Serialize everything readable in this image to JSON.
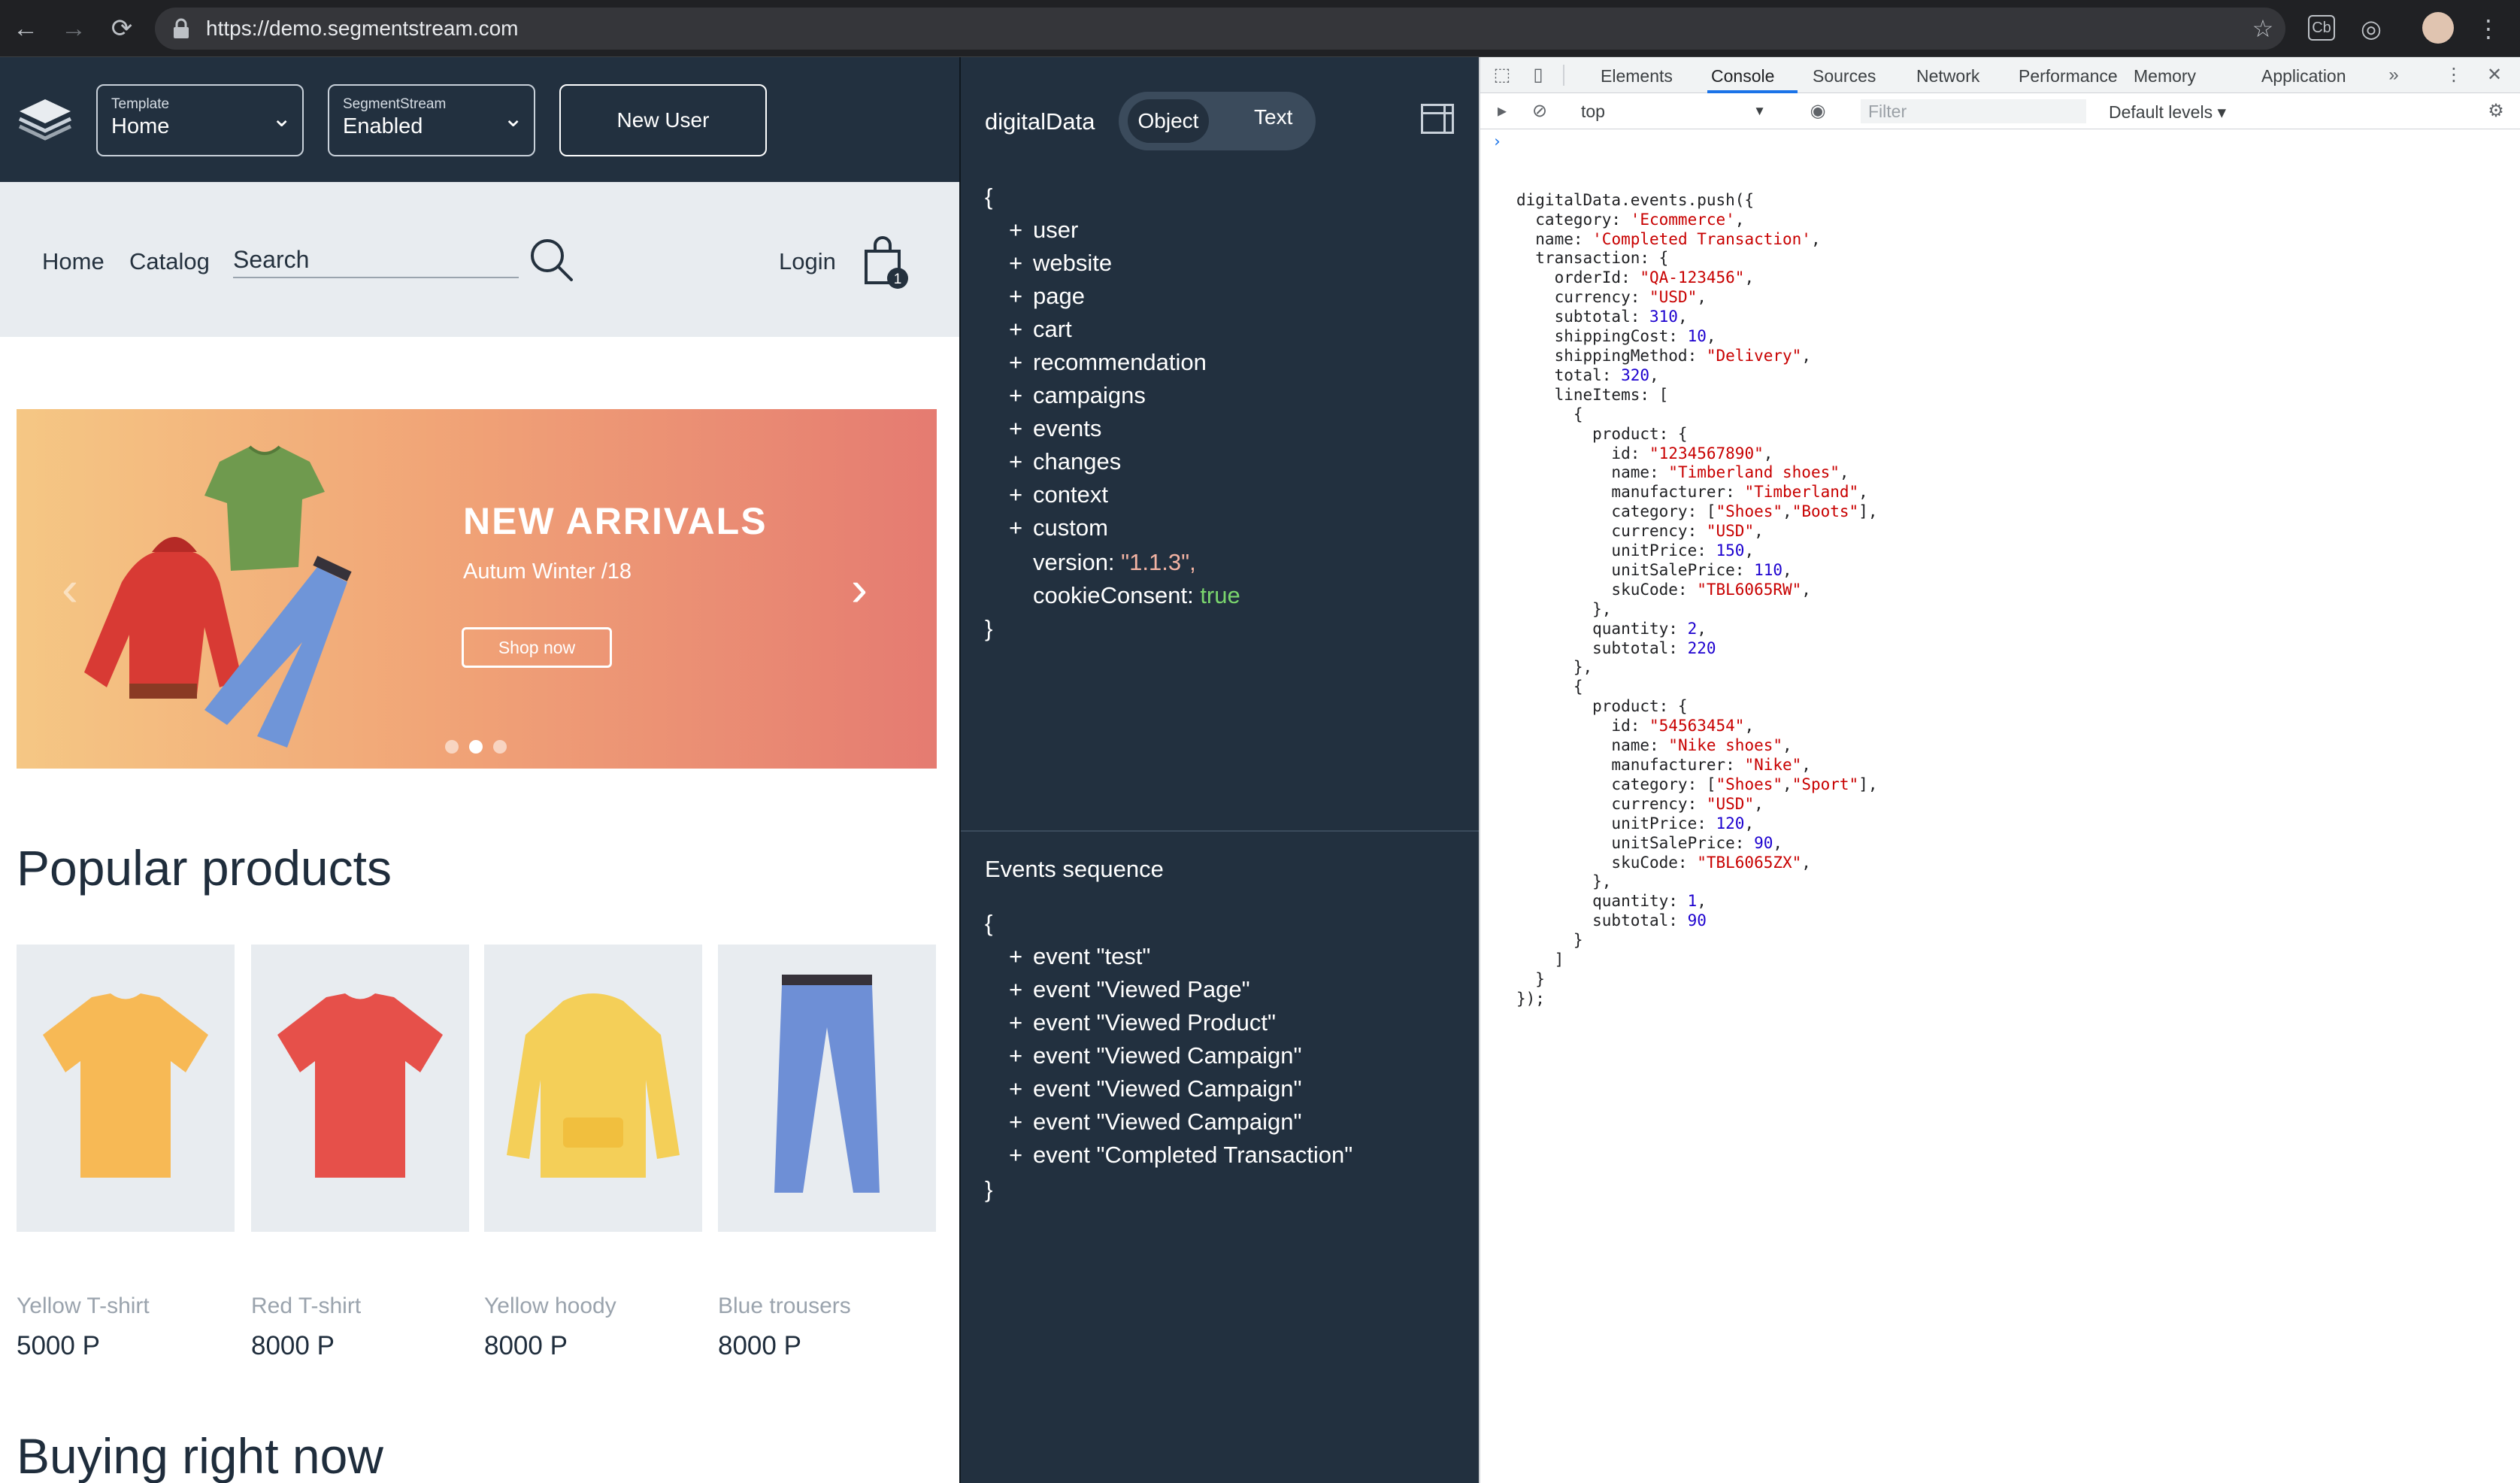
{
  "browser": {
    "url": "https://demo.segmentstream.com"
  },
  "site": {
    "template_label": "Template",
    "template_value": "Home",
    "segmentstream_label": "SegmentStream",
    "segmentstream_value": "Enabled",
    "new_user_label": "New User",
    "nav": {
      "home": "Home",
      "catalog": "Catalog",
      "search_placeholder": "Search",
      "login": "Login",
      "cart_count": "1"
    },
    "banner": {
      "title": "NEW ARRIVALS",
      "subtitle": "Autum Winter /18",
      "button": "Shop now",
      "active_dot": 2
    },
    "popular_title": "Popular products",
    "products": [
      {
        "name": "Yellow T-shirt",
        "price": "5000 P",
        "color": "#f7b955"
      },
      {
        "name": "Red T-shirt",
        "price": "8000 P",
        "color": "#e6504a"
      },
      {
        "name": "Yellow hoody",
        "price": "8000 P",
        "color": "#f4cf58"
      },
      {
        "name": "Blue trousers",
        "price": "8000 P",
        "color": "#6e8fd6"
      }
    ],
    "buying_title": "Buying right now"
  },
  "digitalData": {
    "title": "digitalData",
    "toggle_object": "Object",
    "toggle_text": "Text",
    "open_brace": "{",
    "close_brace": "}",
    "keys": [
      "user",
      "website",
      "page",
      "cart",
      "recommendation",
      "campaigns",
      "events",
      "changes",
      "context",
      "custom"
    ],
    "version_key": "version:",
    "version_value": "\"1.1.3\",",
    "consent_key": "cookieConsent:",
    "consent_value": "true",
    "events_title": "Events sequence",
    "events": [
      "event \"test\"",
      "event \"Viewed Page\"",
      "event \"Viewed Product\"",
      "event \"Viewed Campaign\"",
      "event \"Viewed Campaign\"",
      "event \"Viewed Campaign\"",
      "event \"Completed Transaction\""
    ]
  },
  "devtools": {
    "tabs": [
      "Elements",
      "Console",
      "Sources",
      "Network",
      "Performance",
      "Memory",
      "Application"
    ],
    "active_tab": "Console",
    "context": "top",
    "filter_placeholder": "Filter",
    "levels": "Default levels ▾",
    "console_lines": [
      [
        [
          "",
          "digitalData.events.push({"
        ]
      ],
      [
        [
          "",
          "  category: "
        ],
        [
          "s",
          "'Ecommerce'"
        ],
        [
          "",
          ","
        ]
      ],
      [
        [
          "",
          "  name: "
        ],
        [
          "s",
          "'Completed Transaction'"
        ],
        [
          "",
          ","
        ]
      ],
      [
        [
          "",
          "  transaction: {"
        ]
      ],
      [
        [
          "",
          "    orderId: "
        ],
        [
          "s",
          "\"QA-123456\""
        ],
        [
          "",
          ","
        ]
      ],
      [
        [
          "",
          "    currency: "
        ],
        [
          "s",
          "\"USD\""
        ],
        [
          "",
          ","
        ]
      ],
      [
        [
          "",
          "    subtotal: "
        ],
        [
          "n",
          "310"
        ],
        [
          "",
          ","
        ]
      ],
      [
        [
          "",
          "    shippingCost: "
        ],
        [
          "n",
          "10"
        ],
        [
          "",
          ","
        ]
      ],
      [
        [
          "",
          "    shippingMethod: "
        ],
        [
          "s",
          "\"Delivery\""
        ],
        [
          "",
          ","
        ]
      ],
      [
        [
          "",
          "    total: "
        ],
        [
          "n",
          "320"
        ],
        [
          "",
          ","
        ]
      ],
      [
        [
          "",
          "    lineItems: ["
        ]
      ],
      [
        [
          "",
          "      {"
        ]
      ],
      [
        [
          "",
          "        product: {"
        ]
      ],
      [
        [
          "",
          "          id: "
        ],
        [
          "s",
          "\"1234567890\""
        ],
        [
          "",
          ","
        ]
      ],
      [
        [
          "",
          "          name: "
        ],
        [
          "s",
          "\"Timberland shoes\""
        ],
        [
          "",
          ","
        ]
      ],
      [
        [
          "",
          "          manufacturer: "
        ],
        [
          "s",
          "\"Timberland\""
        ],
        [
          "",
          ","
        ]
      ],
      [
        [
          "",
          "          category: ["
        ],
        [
          "s",
          "\"Shoes\""
        ],
        [
          "",
          ","
        ],
        [
          "s",
          "\"Boots\""
        ],
        [
          "",
          "],"
        ]
      ],
      [
        [
          "",
          "          currency: "
        ],
        [
          "s",
          "\"USD\""
        ],
        [
          "",
          ","
        ]
      ],
      [
        [
          "",
          "          unitPrice: "
        ],
        [
          "n",
          "150"
        ],
        [
          "",
          ","
        ]
      ],
      [
        [
          "",
          "          unitSalePrice: "
        ],
        [
          "n",
          "110"
        ],
        [
          "",
          ","
        ]
      ],
      [
        [
          "",
          "          skuCode: "
        ],
        [
          "s",
          "\"TBL6065RW\""
        ],
        [
          "",
          ","
        ]
      ],
      [
        [
          "",
          "        },"
        ]
      ],
      [
        [
          "",
          "        quantity: "
        ],
        [
          "n",
          "2"
        ],
        [
          "",
          ","
        ]
      ],
      [
        [
          "",
          "        subtotal: "
        ],
        [
          "n",
          "220"
        ]
      ],
      [
        [
          "",
          "      },"
        ]
      ],
      [
        [
          "",
          "      {"
        ]
      ],
      [
        [
          "",
          "        product: {"
        ]
      ],
      [
        [
          "",
          "          id: "
        ],
        [
          "s",
          "\"54563454\""
        ],
        [
          "",
          ","
        ]
      ],
      [
        [
          "",
          "          name: "
        ],
        [
          "s",
          "\"Nike shoes\""
        ],
        [
          "",
          ","
        ]
      ],
      [
        [
          "",
          "          manufacturer: "
        ],
        [
          "s",
          "\"Nike\""
        ],
        [
          "",
          ","
        ]
      ],
      [
        [
          "",
          "          category: ["
        ],
        [
          "s",
          "\"Shoes\""
        ],
        [
          "",
          ","
        ],
        [
          "s",
          "\"Sport\""
        ],
        [
          "",
          "],"
        ]
      ],
      [
        [
          "",
          "          currency: "
        ],
        [
          "s",
          "\"USD\""
        ],
        [
          "",
          ","
        ]
      ],
      [
        [
          "",
          "          unitPrice: "
        ],
        [
          "n",
          "120"
        ],
        [
          "",
          ","
        ]
      ],
      [
        [
          "",
          "          unitSalePrice: "
        ],
        [
          "n",
          "90"
        ],
        [
          "",
          ","
        ]
      ],
      [
        [
          "",
          "          skuCode: "
        ],
        [
          "s",
          "\"TBL6065ZX\""
        ],
        [
          "",
          ","
        ]
      ],
      [
        [
          "",
          "        },"
        ]
      ],
      [
        [
          "",
          "        quantity: "
        ],
        [
          "n",
          "1"
        ],
        [
          "",
          ","
        ]
      ],
      [
        [
          "",
          "        subtotal: "
        ],
        [
          "n",
          "90"
        ]
      ],
      [
        [
          "",
          "      }"
        ]
      ],
      [
        [
          "",
          "    ]"
        ]
      ],
      [
        [
          "",
          "  }"
        ]
      ],
      [
        [
          "",
          "});"
        ]
      ]
    ]
  }
}
